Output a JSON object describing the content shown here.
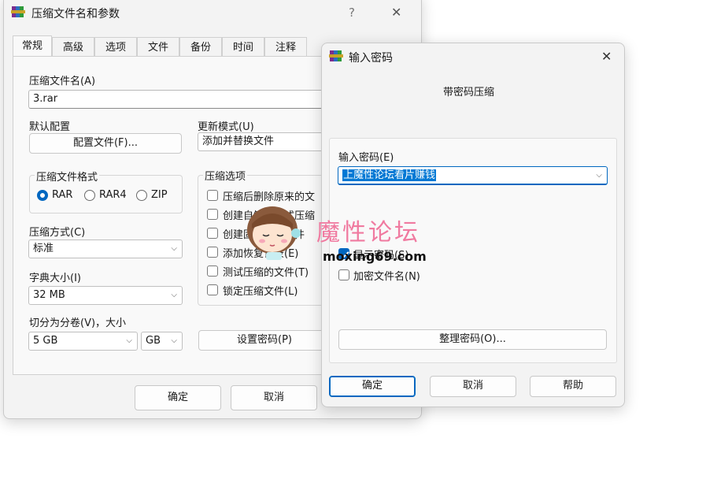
{
  "main_dialog": {
    "title": "压缩文件名和参数",
    "help_glyph": "?",
    "close_glyph": "✕",
    "tabs": [
      "常规",
      "高级",
      "选项",
      "文件",
      "备份",
      "时间",
      "注释"
    ],
    "archive_name_label": "压缩文件名(A)",
    "archive_name_value": "3.rar",
    "default_profile_label": "默认配置",
    "profiles_button": "配置文件(F)...",
    "update_mode_label": "更新模式(U)",
    "update_mode_value": "添加并替换文件",
    "format_group_label": "压缩文件格式",
    "formats": [
      "RAR",
      "RAR4",
      "ZIP"
    ],
    "selected_format": "RAR",
    "options_group_label": "压缩选项",
    "options": [
      {
        "label": "压缩后删除原来的文",
        "checked": false
      },
      {
        "label": "创建自解压格式压缩",
        "checked": false
      },
      {
        "label": "创建固实压缩文件",
        "checked": false
      },
      {
        "label": "添加恢复记录(E)",
        "checked": false
      },
      {
        "label": "测试压缩的文件(T)",
        "checked": false
      },
      {
        "label": "锁定压缩文件(L)",
        "checked": false
      }
    ],
    "method_label": "压缩方式(C)",
    "method_value": "标准",
    "dict_label": "字典大小(I)",
    "dict_value": "32 MB",
    "split_label": "切分为分卷(V)，大小",
    "split_value": "5 GB",
    "split_unit": "GB",
    "set_password_button": "设置密码(P)",
    "ok_button": "确定",
    "cancel_button": "取消"
  },
  "password_dialog": {
    "title": "输入密码",
    "close_glyph": "✕",
    "heading": "带密码压缩",
    "password_label": "输入密码(E)",
    "password_value": "上魔性论坛看片赚钱",
    "show_password_label": "显示密码(S)",
    "show_password_checked": true,
    "encrypt_names_label": "加密文件名(N)",
    "encrypt_names_checked": false,
    "organize_button": "整理密码(O)...",
    "ok_button": "确定",
    "cancel_button": "取消",
    "help_button": "帮助"
  },
  "watermark": {
    "site_name": "魔性论坛",
    "domain": "moxing69.com"
  },
  "colors": {
    "accent": "#0067c0",
    "watermark_pink": "#f07aa0"
  }
}
